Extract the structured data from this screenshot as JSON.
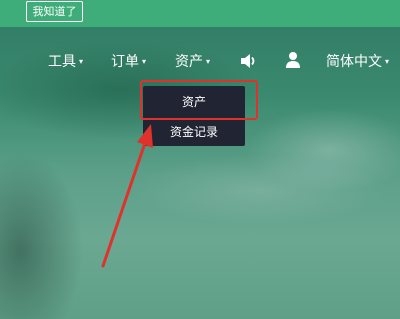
{
  "notice_button": "我知道了",
  "nav": {
    "tools": "工具",
    "orders": "订单",
    "assets": "资产",
    "language": "简体中文",
    "caret": "▾"
  },
  "dropdown": {
    "items": [
      "资产",
      "资金记录"
    ]
  },
  "colors": {
    "topbar": "#3fad79",
    "dropdown_bg": "#212533",
    "annotation_red": "#e0322c"
  },
  "icons": {
    "speaker": "speaker-icon",
    "user": "user-icon"
  }
}
